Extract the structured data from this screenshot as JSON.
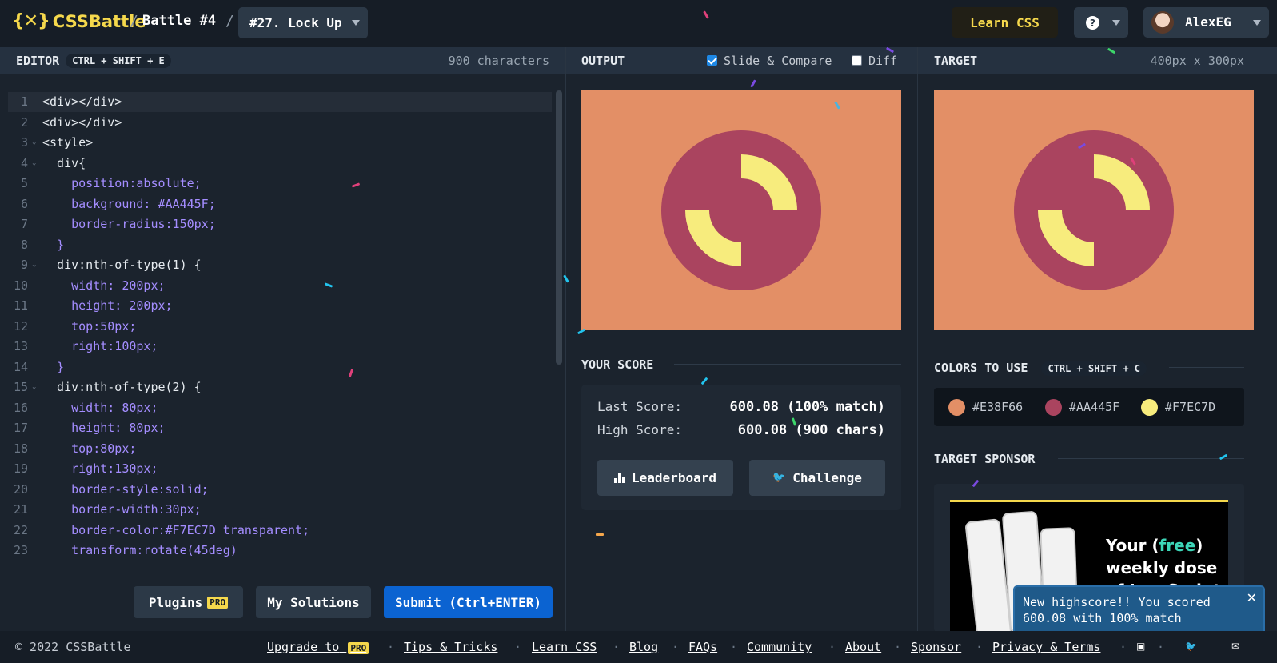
{
  "header": {
    "logo_mark": "{✕}",
    "logo_text": "CSSBattle",
    "battle_link": "Battle #4",
    "challenge_select": "#27. Lock Up",
    "learn_css_button": "Learn CSS",
    "help_icon": "question-circle-icon",
    "user_name": "AlexEG"
  },
  "editor": {
    "title": "EDITOR",
    "shortcut": "CTRL + SHIFT + E",
    "char_count": "900 characters",
    "lines": [
      "<div></div>",
      "<div></div>",
      "<style>",
      "  div{",
      "    position:absolute;",
      "    background: #AA445F;",
      "    border-radius:150px;",
      "  }",
      "  div:nth-of-type(1) {",
      "    width: 200px;",
      "    height: 200px;",
      "    top:50px;",
      "    right:100px;",
      "  }",
      "  div:nth-of-type(2) {",
      "    width: 80px;",
      "    height: 80px;",
      "    top:80px;",
      "    right:130px;",
      "    border-style:solid;",
      "    border-width:30px;",
      "    border-color:#F7EC7D transparent;",
      "    transform:rotate(45deg)"
    ],
    "plugins_button": "Plugins",
    "pro_badge": "PRO",
    "my_solutions_button": "My Solutions",
    "submit_button": "Submit (Ctrl+ENTER)"
  },
  "output": {
    "title": "OUTPUT",
    "slide_compare_label": "Slide & Compare",
    "slide_compare_checked": true,
    "diff_label": "Diff",
    "diff_checked": false
  },
  "score": {
    "title": "YOUR SCORE",
    "last_label": "Last Score:",
    "last_value": "600.08 (100% match)",
    "high_label": "High Score:",
    "high_value": "600.08 (900 chars)",
    "leaderboard_button": "Leaderboard",
    "challenge_button": "Challenge"
  },
  "target": {
    "title": "TARGET",
    "size": "400px x 300px",
    "colors_title": "COLORS TO USE",
    "colors_shortcut": "CTRL + SHIFT + C",
    "colors": [
      "#E38F66",
      "#AA445F",
      "#F7EC7D"
    ],
    "sponsor_title": "TARGET SPONSOR",
    "ad_line1_a": "Your (",
    "ad_line1_b": "free",
    "ad_line1_c": ")",
    "ad_line2": "weekly dose",
    "ad_line3": "of JavaScript"
  },
  "toast": {
    "message": "New highscore!! You scored 600.08 with 100% match"
  },
  "footer": {
    "copyright": "© 2022 CSSBattle",
    "upgrade": "Upgrade to",
    "links": [
      "Tips & Tricks",
      "Learn CSS",
      "Blog",
      "FAQs",
      "Community",
      "About",
      "Sponsor",
      "Privacy & Terms"
    ]
  },
  "colors": {
    "bg": "#1b232d",
    "accent_yellow": "#f5d84c",
    "submit_blue": "#0b63d1",
    "canvas_bg": "#E38F66",
    "circle": "#AA445F",
    "ring": "#F7EC7D"
  }
}
